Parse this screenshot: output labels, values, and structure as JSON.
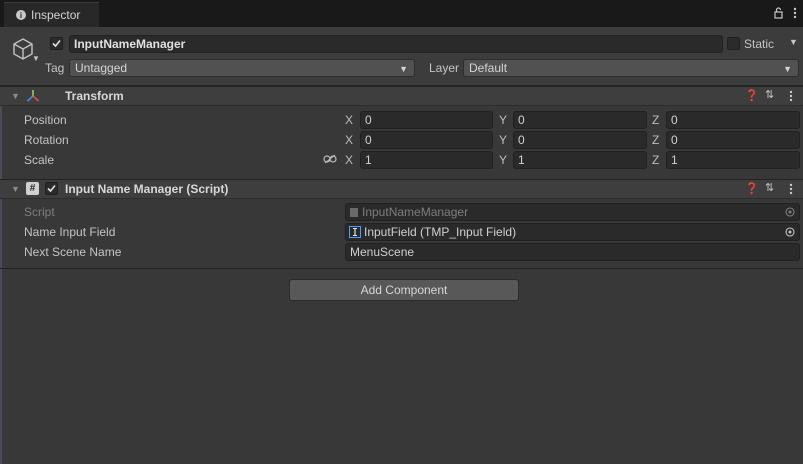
{
  "tab": {
    "title": "Inspector"
  },
  "object": {
    "name": "InputNameManager",
    "active": true,
    "static_label": "Static",
    "tag_label": "Tag",
    "tag_value": "Untagged",
    "layer_label": "Layer",
    "layer_value": "Default"
  },
  "transform": {
    "title": "Transform",
    "rows": [
      {
        "label": "Position",
        "x": "0",
        "y": "0",
        "z": "0"
      },
      {
        "label": "Rotation",
        "x": "0",
        "y": "0",
        "z": "0"
      },
      {
        "label": "Scale",
        "x": "1",
        "y": "1",
        "z": "1"
      }
    ],
    "axes": {
      "x": "X",
      "y": "Y",
      "z": "Z"
    }
  },
  "script_component": {
    "title": "Input Name Manager (Script)",
    "enabled": true,
    "script_label": "Script",
    "script_value": "InputNameManager",
    "name_input_label": "Name Input Field",
    "name_input_value": "InputField (TMP_Input Field)",
    "next_scene_label": "Next Scene Name",
    "next_scene_value": "MenuScene"
  },
  "add_component_label": "Add Component",
  "colors": {
    "background": "#383838",
    "field": "#2a2a2a",
    "tabbar": "#191919"
  },
  "icons": [
    "info-icon",
    "lock-icon",
    "kebab-menu-icon",
    "gameobject-cube-icon",
    "transform-axes-icon",
    "help-icon",
    "preset-icon",
    "script-hash-icon",
    "link-icon",
    "object-picker-icon",
    "input-field-icon"
  ]
}
